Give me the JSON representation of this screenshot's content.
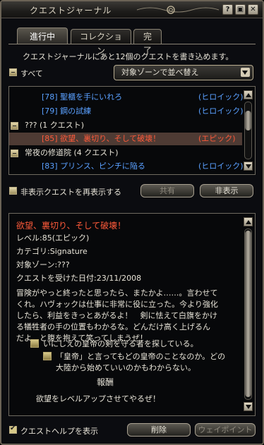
{
  "window": {
    "title": "クエストジャーナル"
  },
  "title_buttons": [
    {
      "label": "?",
      "icon": "help-icon"
    },
    {
      "label": "▣",
      "icon": "restore-icon"
    },
    {
      "label": "✕",
      "icon": "close-icon"
    }
  ],
  "tabs": [
    {
      "label": "進行中"
    },
    {
      "label": "コレクション"
    },
    {
      "label": "完了"
    }
  ],
  "info": "クエストジャーナルにあと12個のクエストを書き込めます。",
  "filter": {
    "all_label": "すべて",
    "sort_value": "対象ゾーンで並べ替え"
  },
  "quests": [
    {
      "name": "[78] 聖櫃を手にいれろ",
      "tag": "(ヒロイック)",
      "color": "#5aa0ff",
      "indent": 1
    },
    {
      "name": "[79] 鋼の試練",
      "tag": "(ヒロイック)",
      "color": "#5aa0ff",
      "indent": 1
    },
    {
      "name": "??? (1 クエスト)",
      "tag": "",
      "color": "#e8e4d8",
      "indent": 0
    },
    {
      "name": "[85] 欲望、裏切り、そして破壊！",
      "tag": "(エピック)",
      "color": "#ff5a3a",
      "indent": 1,
      "selected": true
    },
    {
      "name": "常夜の修道院 (4 クエスト)",
      "tag": "",
      "color": "#e8e4d8",
      "indent": 0
    },
    {
      "name": "[83] プリンス、ピンチに陥る",
      "tag": "(ヒロイック)",
      "color": "#5aa0ff",
      "indent": 1
    }
  ],
  "reshow_label": "非表示クエストを再表示する",
  "buttons": {
    "share": "共有",
    "hide": "非表示",
    "delete": "削除",
    "waypoint": "ウェイポイント"
  },
  "detail": {
    "title": "欲望、裏切り、そして破壊！",
    "level": "レベル:85(エピック)",
    "category": "カテゴリ:Signature",
    "zone": "対象ゾーン:???",
    "date": "クエストを受けた日付:23/11/2008",
    "desc": [
      "冒険がやっと終ったと思ったら、またかよ……。言わせて",
      "くれ。ハヴォックは仕事に非常に役に立った。今より強化",
      "したら、利益をきっとあがるよ！　剣に怯えて白旗をかけ",
      "る犠牲者の手の位置もわかるな。どんだけ高く上げるん",
      "だよ、と腹を抱えて笑ってしまうぜ！"
    ],
    "objective1": "いにしえの皇帝の剣を守る者を探している。",
    "objective2_lines": [
      "「皇帝」と言ってもどの皇帝のことなのか。どの",
      "大陸から始めていいのかもわからない。"
    ],
    "reward_title": "報酬",
    "reward_text": "欲望をレベルアップさせてやるぜ！"
  },
  "help_label": "クエストヘルプを表示",
  "colors": {
    "heroic": "#5aa0ff",
    "epic": "#ff5a3a",
    "selected_bg": "#4e3b34"
  }
}
